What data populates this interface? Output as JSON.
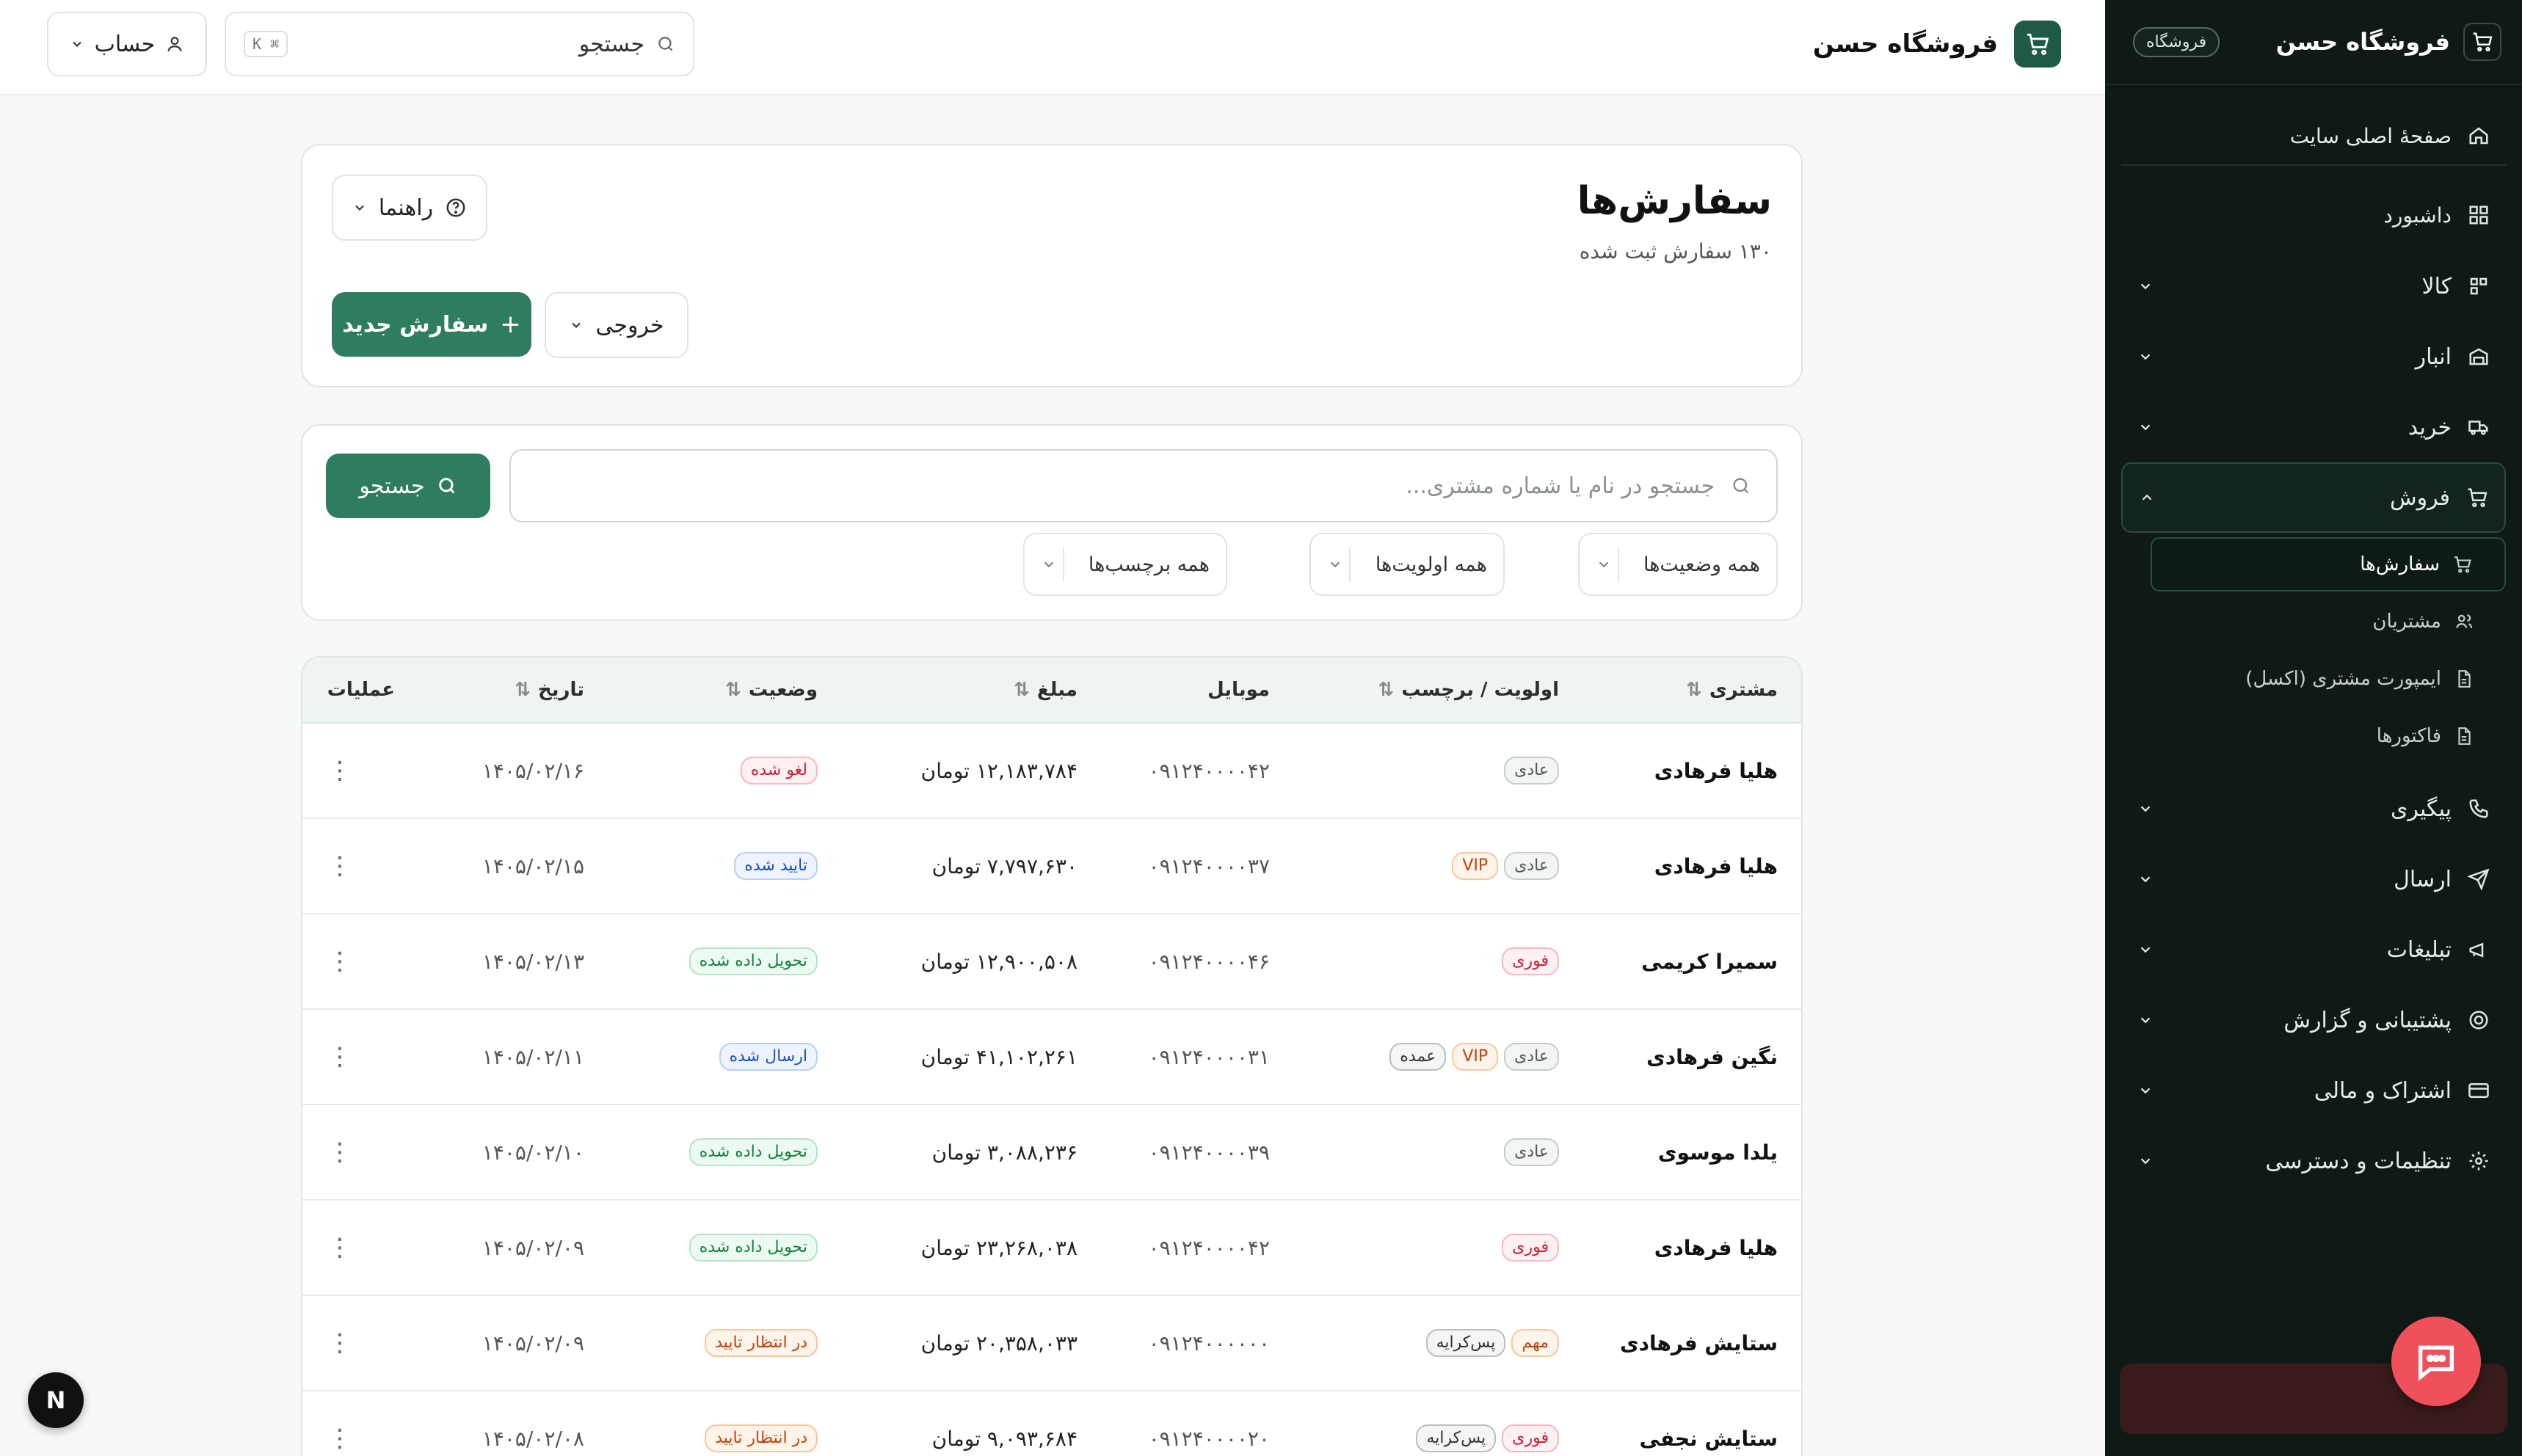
{
  "sidebar": {
    "brand": "فروشگاه حسن",
    "badge": "فروشگاه",
    "home": "صفحهٔ اصلی سایت",
    "dashboard": "داشبورد",
    "items": [
      {
        "label": "کالا",
        "icon": "boxes-icon"
      },
      {
        "label": "انبار",
        "icon": "warehouse-icon"
      },
      {
        "label": "خرید",
        "icon": "truck-icon"
      },
      {
        "label": "فروش",
        "icon": "cart-icon"
      },
      {
        "label": "پیگیری",
        "icon": "phone-icon"
      },
      {
        "label": "ارسال",
        "icon": "send-icon"
      },
      {
        "label": "تبلیغات",
        "icon": "megaphone-icon"
      },
      {
        "label": "پشتیبانی و گزارش",
        "icon": "lifebuoy-icon"
      },
      {
        "label": "اشتراک و مالی",
        "icon": "card-icon"
      },
      {
        "label": "تنظیمات و دسترسی",
        "icon": "gear-icon"
      }
    ],
    "sales_sub": [
      "سفارش‌ها",
      "مشتریان",
      "ایمپورت مشتری (اکسل)",
      "فاکتورها"
    ]
  },
  "topbar": {
    "brand": "فروشگاه حسن",
    "search_placeholder": "جستجو",
    "shortcut": "⌘ K",
    "account": "حساب"
  },
  "page": {
    "title": "سفارش‌ها",
    "subtitle": "۱۳۰ سفارش ثبت شده",
    "help": "راهنما",
    "export": "خروجی",
    "new_order": "سفارش جدید"
  },
  "filters": {
    "search_placeholder": "جستجو در نام یا شماره مشتری...",
    "search_button": "جستجو",
    "status": "همه وضعیت‌ها",
    "priority": "همه اولویت‌ها",
    "tags": "همه برچسب‌ها"
  },
  "table": {
    "headers": {
      "customer": "مشتری",
      "priority": "اولویت / برچسب",
      "mobile": "موبایل",
      "amount": "مبلغ",
      "status": "وضعیت",
      "date": "تاریخ",
      "actions": "عملیات"
    },
    "rows": [
      {
        "customer": "هلیا فرهادی",
        "tags": [
          {
            "t": "عادی",
            "k": "normal"
          }
        ],
        "mobile": "۰۹۱۲۴۰۰۰۰۴۲",
        "amount": "۱۲,۱۸۳,۷۸۴ تومان",
        "status": "لغو شده",
        "sk": "cancel",
        "date": "۱۴۰۵/۰۲/۱۶"
      },
      {
        "customer": "هلیا فرهادی",
        "tags": [
          {
            "t": "عادی",
            "k": "normal"
          },
          {
            "t": "VIP",
            "k": "vip"
          }
        ],
        "mobile": "۰۹۱۲۴۰۰۰۰۳۷",
        "amount": "۷,۷۹۷,۶۳۰ تومان",
        "status": "تایید شده",
        "sk": "approved",
        "date": "۱۴۰۵/۰۲/۱۵"
      },
      {
        "customer": "سمیرا کریمی",
        "tags": [
          {
            "t": "فوری",
            "k": "fast"
          }
        ],
        "mobile": "۰۹۱۲۴۰۰۰۰۴۶",
        "amount": "۱۲,۹۰۰,۵۰۸ تومان",
        "status": "تحویل داده شده",
        "sk": "delivered",
        "date": "۱۴۰۵/۰۲/۱۳"
      },
      {
        "customer": "نگین فرهادی",
        "tags": [
          {
            "t": "عادی",
            "k": "normal"
          },
          {
            "t": "VIP",
            "k": "vip"
          },
          {
            "t": "عمده",
            "k": "tag"
          }
        ],
        "mobile": "۰۹۱۲۴۰۰۰۰۳۱",
        "amount": "۴۱,۱۰۲,۲۶۱ تومان",
        "status": "ارسال شده",
        "sk": "sent",
        "date": "۱۴۰۵/۰۲/۱۱"
      },
      {
        "customer": "یلدا موسوی",
        "tags": [
          {
            "t": "عادی",
            "k": "normal"
          }
        ],
        "mobile": "۰۹۱۲۴۰۰۰۰۳۹",
        "amount": "۳,۰۸۸,۲۳۶ تومان",
        "status": "تحویل داده شده",
        "sk": "delivered",
        "date": "۱۴۰۵/۰۲/۱۰"
      },
      {
        "customer": "هلیا فرهادی",
        "tags": [
          {
            "t": "فوری",
            "k": "fast"
          }
        ],
        "mobile": "۰۹۱۲۴۰۰۰۰۴۲",
        "amount": "۲۳,۲۶۸,۰۳۸ تومان",
        "status": "تحویل داده شده",
        "sk": "delivered",
        "date": "۱۴۰۵/۰۲/۰۹"
      },
      {
        "customer": "ستایش فرهادی",
        "tags": [
          {
            "t": "مهم",
            "k": "imp"
          },
          {
            "t": "پس‌کرایه",
            "k": "tag"
          }
        ],
        "mobile": "۰۹۱۲۴۰۰۰۰۰۰",
        "amount": "۲۰,۳۵۸,۰۳۳ تومان",
        "status": "در انتظار تایید",
        "sk": "pending",
        "date": "۱۴۰۵/۰۲/۰۹"
      },
      {
        "customer": "ستایش نجفی",
        "tags": [
          {
            "t": "فوری",
            "k": "fast"
          },
          {
            "t": "پس‌کرایه",
            "k": "tag"
          }
        ],
        "mobile": "۰۹۱۲۴۰۰۰۰۲۰",
        "amount": "۹,۰۹۳,۶۸۴ تومان",
        "status": "در انتظار تایید",
        "sk": "pending",
        "date": "۱۴۰۵/۰۲/۰۸"
      }
    ]
  },
  "colors": {
    "accent": "#2e7d5f",
    "sidebar_bg": "#0f1a16"
  },
  "fab": "N"
}
